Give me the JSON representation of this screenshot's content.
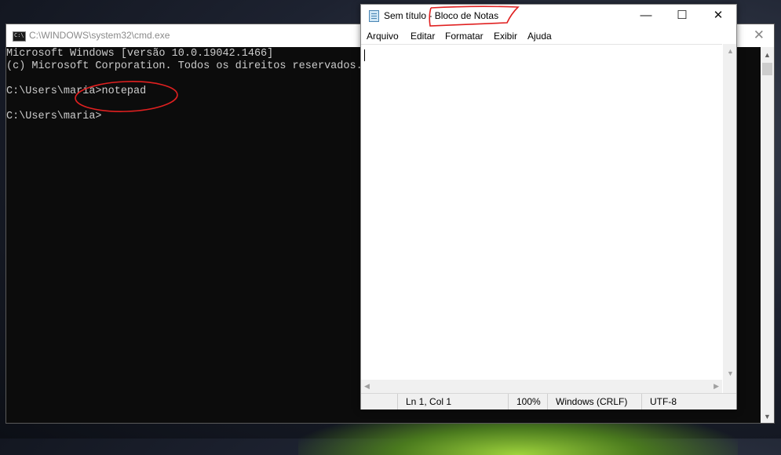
{
  "cmd": {
    "title": "C:\\WINDOWS\\system32\\cmd.exe",
    "icon_glyph": "C:\\",
    "close_glyph": "✕",
    "lines": [
      "Microsoft Windows [versão 10.0.19042.1466]",
      "(c) Microsoft Corporation. Todos os direitos reservados.",
      "",
      "C:\\Users\\maria>notepad",
      "",
      "C:\\Users\\maria>"
    ]
  },
  "notepad": {
    "title": "Sem título - Bloco de Notas",
    "menu": [
      "Arquivo",
      "Editar",
      "Formatar",
      "Exibir",
      "Ajuda"
    ],
    "min_glyph": "—",
    "max_glyph": "☐",
    "close_glyph": "✕",
    "status": {
      "position": "Ln 1, Col 1",
      "zoom": "100%",
      "line_ending": "Windows (CRLF)",
      "encoding": "UTF-8"
    }
  },
  "annotation_color": "#e02020"
}
